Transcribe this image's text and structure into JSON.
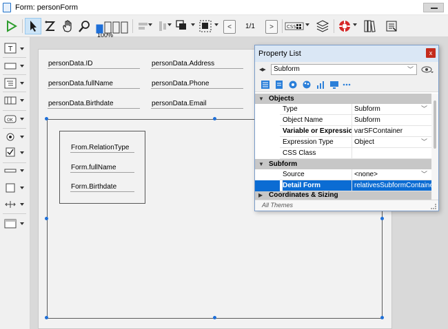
{
  "window": {
    "title": "Form: personForm"
  },
  "toolbar": {
    "zoom_label": "100%",
    "page_indicator": "1/1",
    "css_button_label": "CSS",
    "prev_page": "<",
    "next_page": ">"
  },
  "form": {
    "fields": [
      "personData.ID",
      "personData.Address",
      "personData.fullName",
      "personData.Phone",
      "personData.Birthdate",
      "personData.Email"
    ],
    "inner_fields": [
      "From.RelationType",
      "Form.fullName",
      "Form.Birthdate"
    ]
  },
  "property_list": {
    "title": "Property List",
    "close_glyph": "x",
    "object_combo": "Subform",
    "sections": [
      {
        "name": "Objects",
        "rows": [
          {
            "name": "Type",
            "value": "Subform",
            "dropdown": true,
            "bold": false
          },
          {
            "name": "Object Name",
            "value": "Subform",
            "dropdown": false,
            "bold": false
          },
          {
            "name": "Variable or Expression",
            "value": "varSFContainer",
            "dropdown": false,
            "bold": true
          },
          {
            "name": "Expression Type",
            "value": "Object",
            "dropdown": true,
            "bold": false
          },
          {
            "name": "CSS Class",
            "value": "",
            "dropdown": false,
            "bold": false
          }
        ]
      },
      {
        "name": "Subform",
        "rows": [
          {
            "name": "Source",
            "value": "<none>",
            "dropdown": true,
            "bold": false
          },
          {
            "name": "Detail Form",
            "value": "relativesSubformContainer",
            "dropdown": false,
            "bold": true,
            "selected": true
          }
        ]
      },
      {
        "name": "Coordinates & Sizing",
        "rows": []
      }
    ],
    "footer_text": "All Themes"
  },
  "colors": {
    "selection_blue": "#0b6cd3",
    "handle_blue": "#1e6fd8",
    "close_red": "#c42b1c",
    "run_green": "#2e9d2e"
  }
}
